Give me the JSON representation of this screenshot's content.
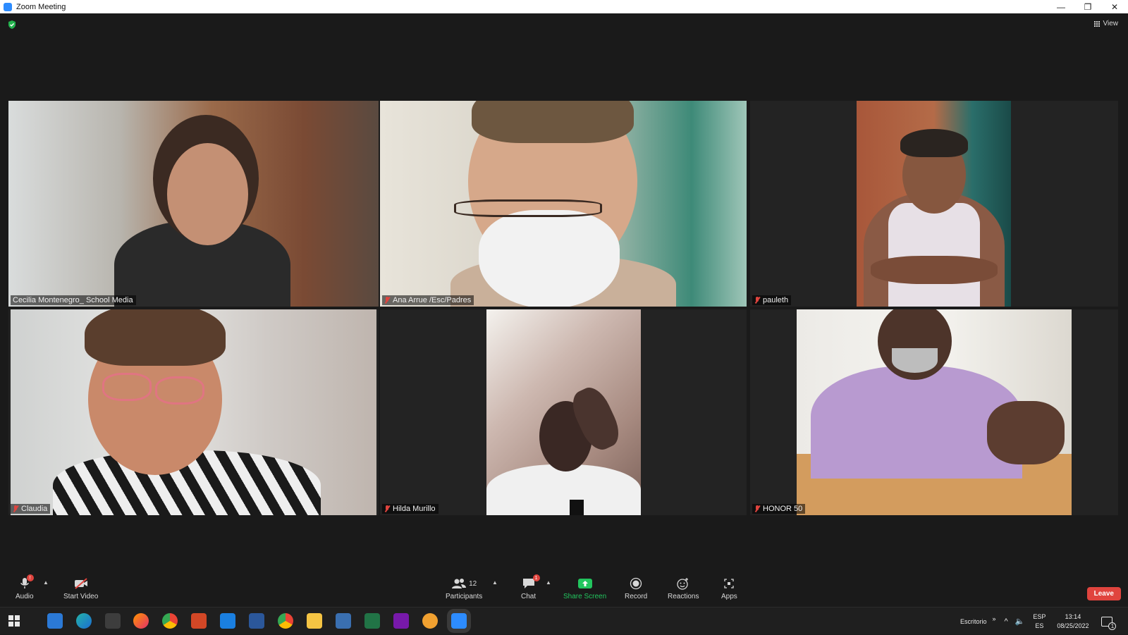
{
  "window": {
    "title": "Zoom Meeting",
    "minimize": "—",
    "restore": "❐",
    "close": "✕"
  },
  "top": {
    "view_label": "View"
  },
  "participants": [
    {
      "name": "Cecilia Montenegro_ School Media",
      "muted": false,
      "active_speaker": true
    },
    {
      "name": "Ana  Arrue /Esc/Padres",
      "muted": true,
      "active_speaker": false
    },
    {
      "name": "pauleth",
      "muted": true,
      "active_speaker": false
    },
    {
      "name": "Claudia",
      "muted": true,
      "active_speaker": false
    },
    {
      "name": "Hilda Murillo",
      "muted": true,
      "active_speaker": false
    },
    {
      "name": "HONOR 50",
      "muted": true,
      "active_speaker": false
    }
  ],
  "toolbar": {
    "audio": "Audio",
    "audio_badge": "!",
    "start_video": "Start Video",
    "participants": "Participants",
    "participants_count": "12",
    "chat": "Chat",
    "chat_badge": "1",
    "share_screen": "Share Screen",
    "record": "Record",
    "reactions": "Reactions",
    "apps": "Apps",
    "leave": "Leave"
  },
  "taskbar": {
    "desktop_label": "Escritorio",
    "lang_top": "ESP",
    "lang_bottom": "ES",
    "time": "13:14",
    "date": "08/25/2022",
    "notification_count": "1"
  },
  "colors": {
    "accent": "#2d8cff",
    "leave": "#e0443e",
    "share": "#22c55e",
    "active_border": "#e7e66a"
  }
}
